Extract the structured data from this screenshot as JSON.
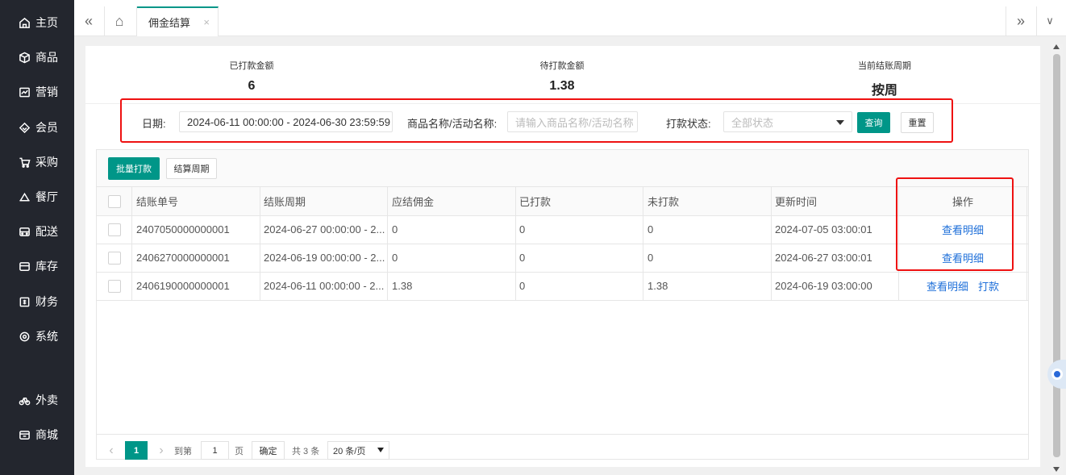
{
  "sidebar": {
    "items": [
      {
        "label": "主页",
        "icon": "home-icon"
      },
      {
        "label": "商品",
        "icon": "box-icon"
      },
      {
        "label": "营销",
        "icon": "chart-icon"
      },
      {
        "label": "会员",
        "icon": "diamond-icon"
      },
      {
        "label": "采购",
        "icon": "cart-icon"
      },
      {
        "label": "餐厅",
        "icon": "cloche-icon"
      },
      {
        "label": "配送",
        "icon": "truck-icon"
      },
      {
        "label": "库存",
        "icon": "warehouse-icon"
      },
      {
        "label": "财务",
        "icon": "finance-icon"
      },
      {
        "label": "系统",
        "icon": "gear-icon"
      },
      {
        "label": "外卖",
        "icon": "bike-icon"
      },
      {
        "label": "商城",
        "icon": "store-icon"
      }
    ]
  },
  "tabbar": {
    "collapse_icon": "«",
    "home_icon": "⌂",
    "active_tab": "佣金结算",
    "close_icon": "×",
    "next_icon": "»",
    "dropdown_icon": "∨"
  },
  "stats": {
    "paid_label": "已打款金额",
    "paid_value": "6",
    "pending_label": "待打款金额",
    "pending_value": "1.38",
    "cycle_label": "当前结账周期",
    "cycle_value": "按周"
  },
  "filters": {
    "date_label": "日期:",
    "date_value": "2024-06-11 00:00:00 - 2024-06-30 23:59:59",
    "name_label": "商品名称/活动名称:",
    "name_placeholder": "请输入商品名称/活动名称",
    "status_label": "打款状态:",
    "status_value": "全部状态",
    "query_button": "查询",
    "reset_button": "重置"
  },
  "toolbar": {
    "batch_pay_button": "批量打款",
    "cycle_button": "结算周期"
  },
  "table": {
    "columns": [
      "结账单号",
      "结账周期",
      "应结佣金",
      "已打款",
      "未打款",
      "更新时间",
      "操作"
    ],
    "rows": [
      {
        "id": "2407050000000001",
        "period": "2024-06-27 00:00:00 - 2...",
        "due": "0",
        "paid": "0",
        "unpaid": "0",
        "updated": "2024-07-05 03:00:01",
        "actions": [
          "查看明细"
        ]
      },
      {
        "id": "2406270000000001",
        "period": "2024-06-19 00:00:00 - 2...",
        "due": "0",
        "paid": "0",
        "unpaid": "0",
        "updated": "2024-06-27 03:00:01",
        "actions": [
          "查看明细"
        ]
      },
      {
        "id": "2406190000000001",
        "period": "2024-06-11 00:00:00 - 2...",
        "due": "1.38",
        "paid": "0",
        "unpaid": "1.38",
        "updated": "2024-06-19 03:00:00",
        "actions": [
          "查看明细",
          "打款"
        ]
      }
    ]
  },
  "pager": {
    "prev_icon": "‹",
    "current_page": "1",
    "next_icon": "›",
    "goto_label": "到第",
    "goto_value": "1",
    "page_unit": "页",
    "confirm_button": "确定",
    "total_text": "共 3 条",
    "page_size": "20 条/页"
  },
  "colors": {
    "sidebar_bg": "#23262e",
    "accent": "#009688",
    "link": "#1e6fd9",
    "highlight": "#ee1111"
  }
}
